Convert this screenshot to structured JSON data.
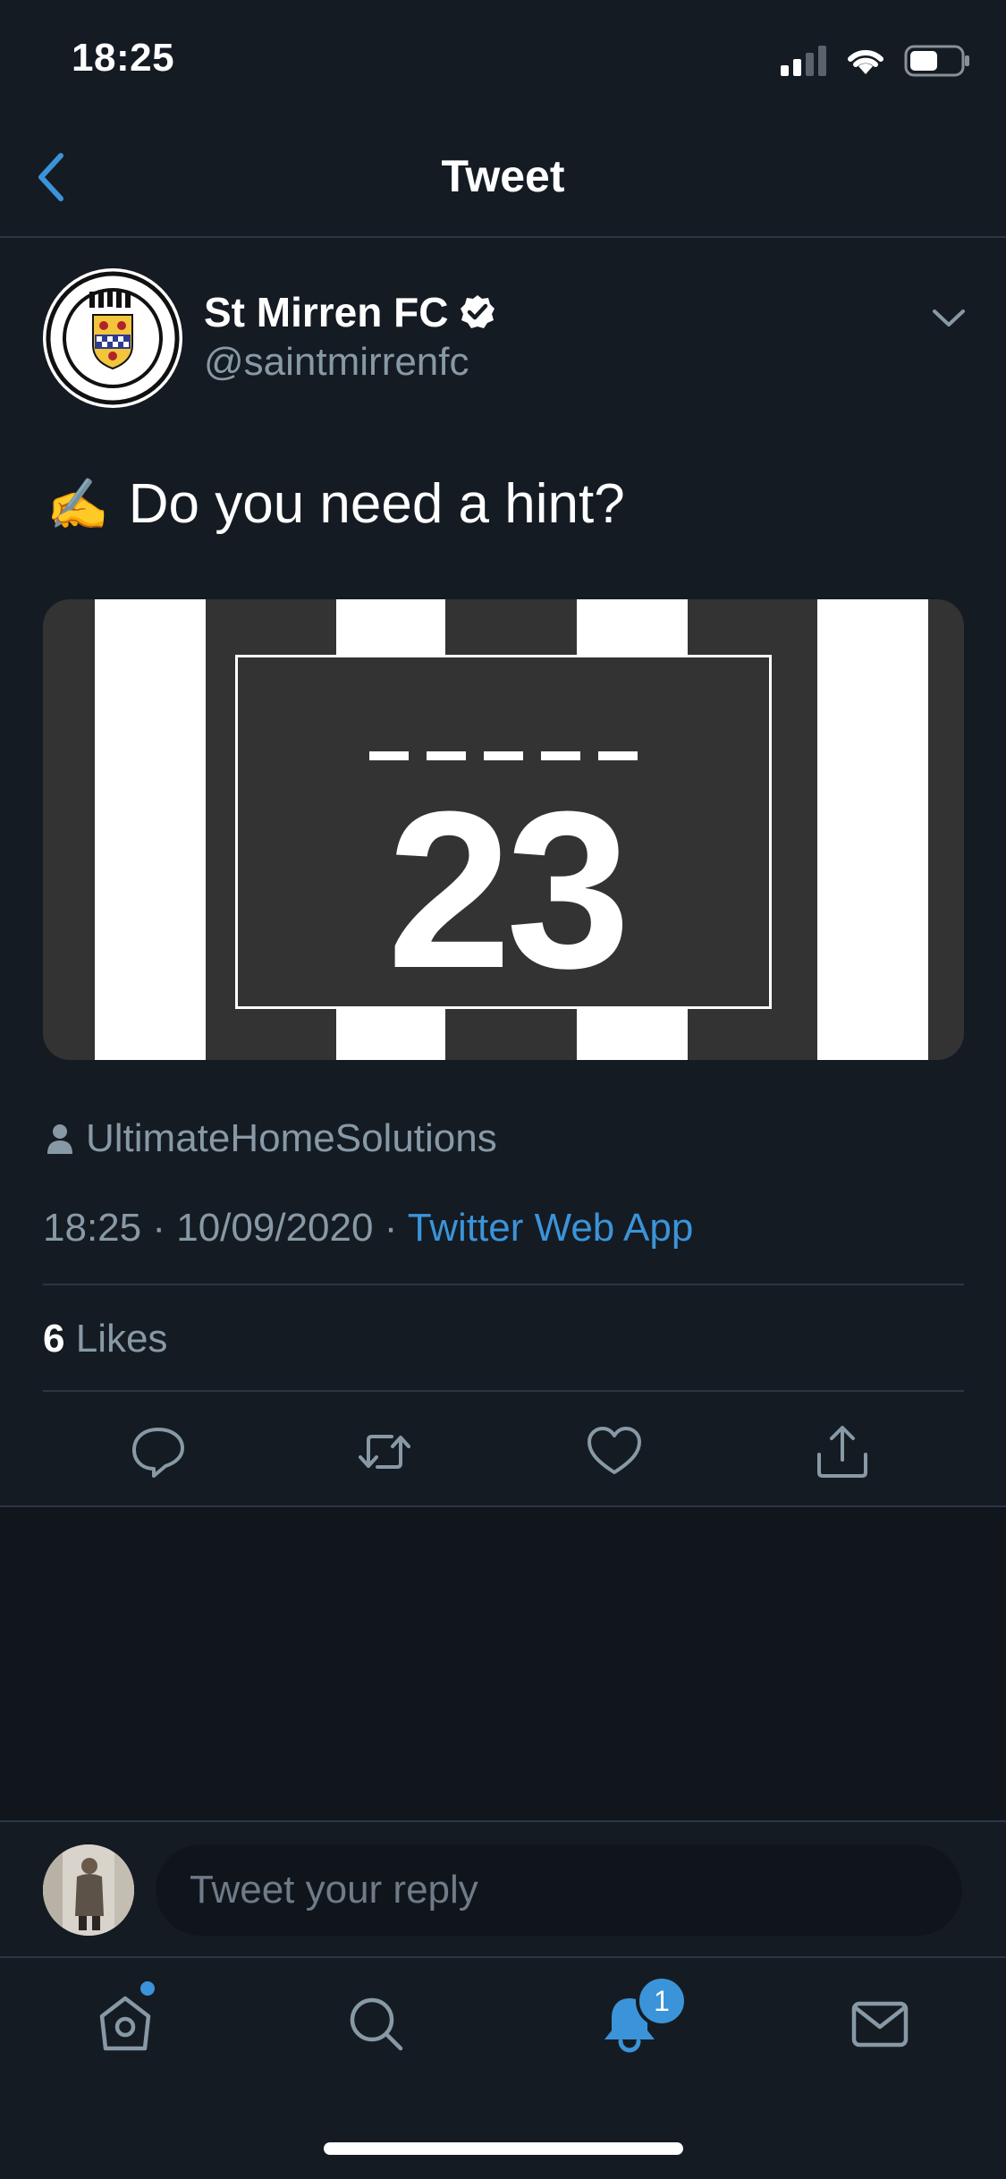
{
  "status_bar": {
    "time": "18:25"
  },
  "nav": {
    "title": "Tweet"
  },
  "tweet": {
    "author_name": "St Mirren FC",
    "author_handle": "@saintmirrenfc",
    "emoji": "✍️",
    "text": "Do you need a hint?",
    "media": {
      "number": "23"
    },
    "promoted_by": "UltimateHomeSolutions",
    "time": "18:25",
    "date": "10/09/2020",
    "source": "Twitter Web App",
    "separator": "·",
    "likes_count": "6",
    "likes_label": "Likes"
  },
  "reply": {
    "placeholder": "Tweet your reply"
  },
  "tabs": {
    "notifications_badge": "1"
  },
  "colors": {
    "background": "#151b23",
    "accent": "#3b94d9",
    "muted": "#8899a6",
    "divider": "#2b3642"
  },
  "icons": [
    "back-icon",
    "verified-icon",
    "chevron-down-icon",
    "person-icon",
    "reply-icon",
    "retweet-icon",
    "like-icon",
    "share-icon",
    "home-icon",
    "search-icon",
    "bell-icon",
    "mail-icon"
  ]
}
